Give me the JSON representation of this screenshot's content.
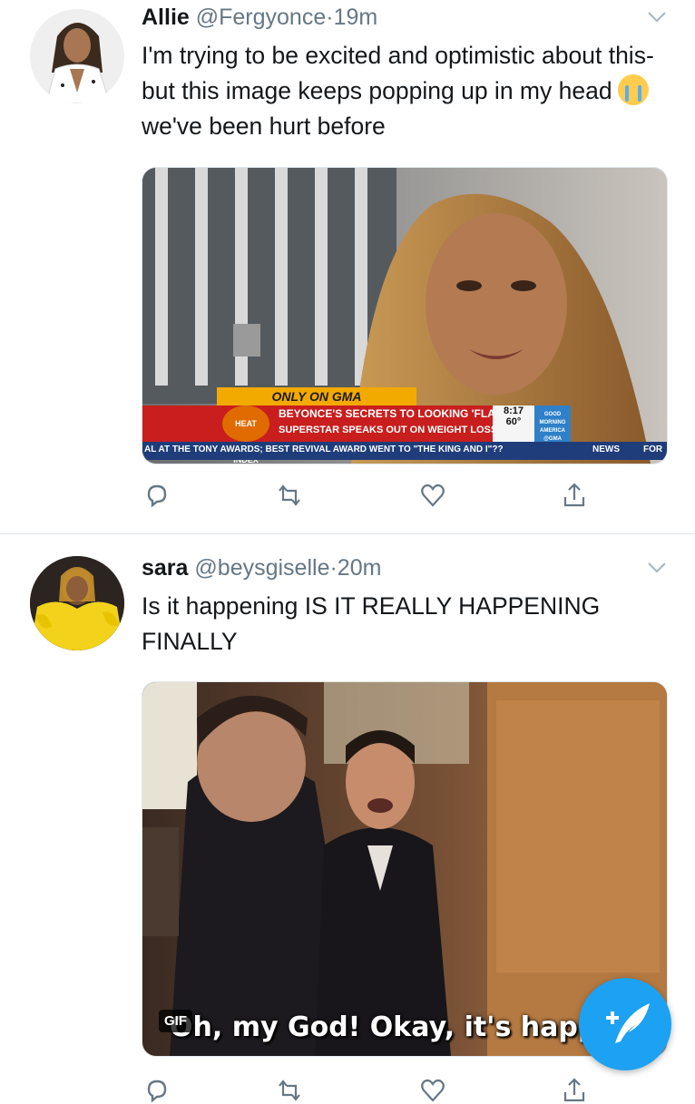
{
  "tweets": [
    {
      "name": "Allie",
      "handle": "@Fergyonce",
      "separator": "·",
      "time": "19m",
      "text_part1": "I'm trying to be excited and optimistic about this- but this image keeps popping up in my head",
      "emoji": "loudly-crying-face",
      "text_part2": "we've been hurt before",
      "media": {
        "ticker_tag": "ONLY ON GMA",
        "headline1": "BEYONCE'S SECRETS TO LOOKING 'FLAWLESS'",
        "headline2": "SUPERSTAR SPEAKS OUT ON WEIGHT LOSS",
        "badge": "HEAT INDEX",
        "clock": "8:17",
        "temp": "60°",
        "brand": "GOOD MORNING AMERICA",
        "brand_small": "@GMA",
        "crawl": "AL AT THE TONY AWARDS; BEST REVIVAL AWARD WENT TO \"THE KING AND I\"??",
        "crawl_news": "NEWS",
        "crawl_next": "FOR"
      }
    },
    {
      "name": "sara",
      "handle": "@beysgiselle",
      "separator": "·",
      "time": "20m",
      "text": "Is it happening IS IT REALLY HAPPENING FINALLY",
      "media": {
        "gif_badge": "GIF",
        "caption": "Oh, my God! Okay, it's happ"
      }
    }
  ],
  "icons": [
    "reply-icon",
    "retweet-icon",
    "like-icon",
    "share-icon",
    "chevron-down-icon",
    "compose-tweet-icon"
  ],
  "colors": {
    "accent": "#1da1f2",
    "secondary_text": "#657786",
    "divider": "#e1e8ed"
  }
}
